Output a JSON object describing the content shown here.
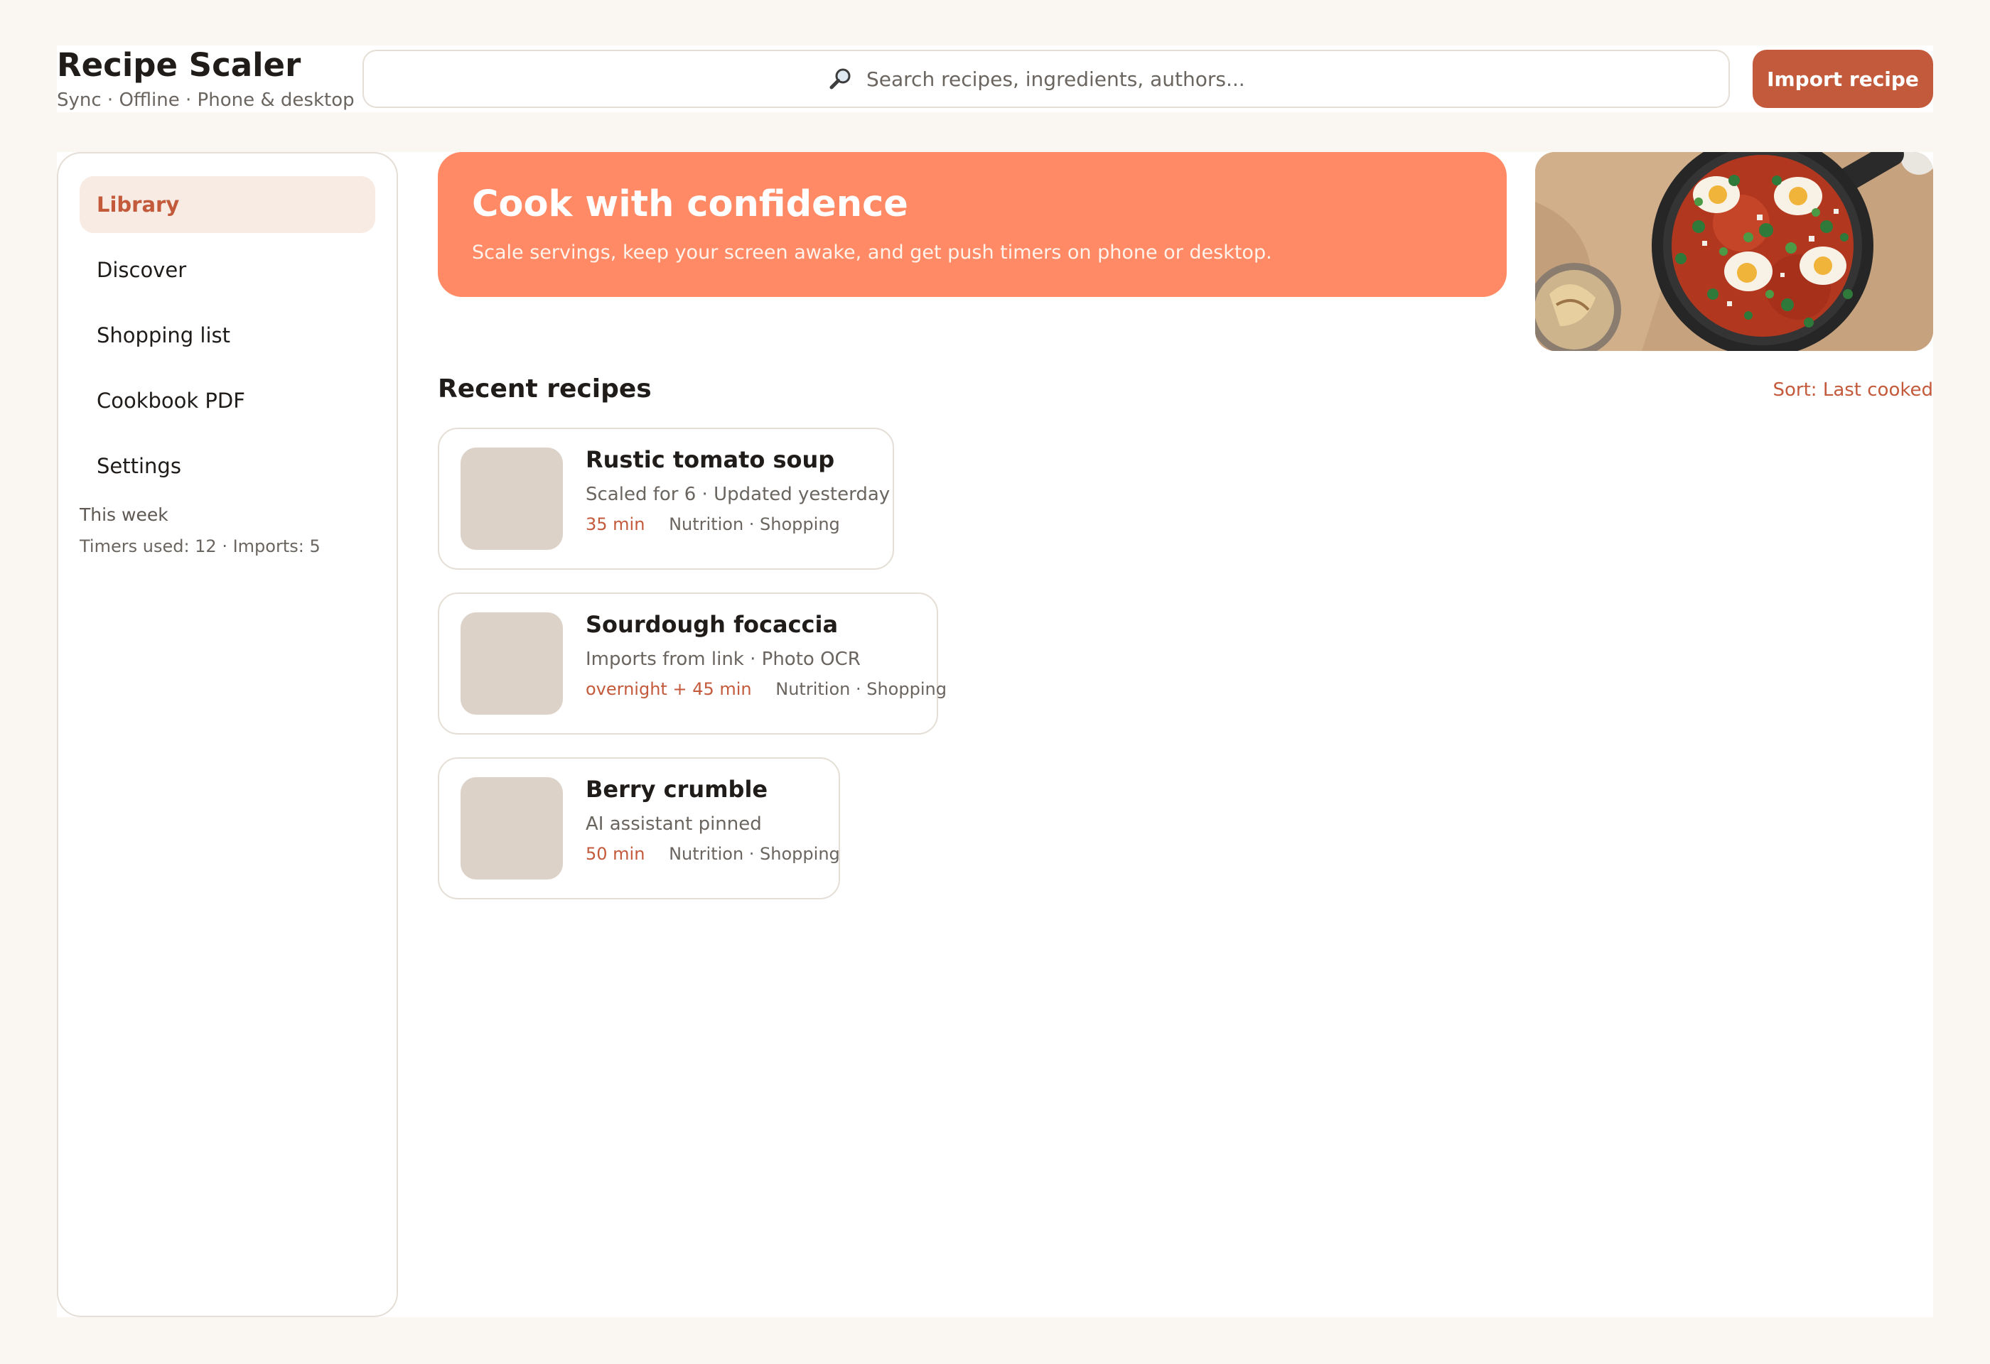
{
  "app": {
    "title": "Recipe Scaler",
    "subtitle": "Sync · Offline · Phone & desktop"
  },
  "search": {
    "icon": "magnifier-icon",
    "placeholder": "Search recipes, ingredients, authors..."
  },
  "header": {
    "import_label": "Import recipe"
  },
  "colors": {
    "accent": "#c45a3c",
    "hero": "#ff8a65",
    "background": "#faf7f2"
  },
  "sidebar": {
    "items": [
      {
        "label": "Library",
        "active": true
      },
      {
        "label": "Discover",
        "active": false
      },
      {
        "label": "Shopping list",
        "active": false
      },
      {
        "label": "Cookbook PDF",
        "active": false
      },
      {
        "label": "Settings",
        "active": false
      }
    ],
    "week_label": "This week",
    "week_stats": "Timers used: 12 · Imports: 5"
  },
  "hero": {
    "title": "Cook with confidence",
    "subtitle": "Scale servings, keep your screen awake, and get push timers on phone or desktop."
  },
  "recent": {
    "title": "Recent recipes",
    "sort_label": "Sort: Last cooked",
    "recipes": [
      {
        "title": "Rustic tomato soup",
        "subtitle": "Scaled for 6 · Updated yesterday",
        "time": "35 min",
        "links": "Nutrition · Shopping"
      },
      {
        "title": "Sourdough focaccia",
        "subtitle": "Imports from link · Photo OCR",
        "time": "overnight + 45 min",
        "links": "Nutrition · Shopping"
      },
      {
        "title": "Berry crumble",
        "subtitle": "AI assistant pinned",
        "time": "50 min",
        "links": "Nutrition · Shopping"
      }
    ]
  }
}
